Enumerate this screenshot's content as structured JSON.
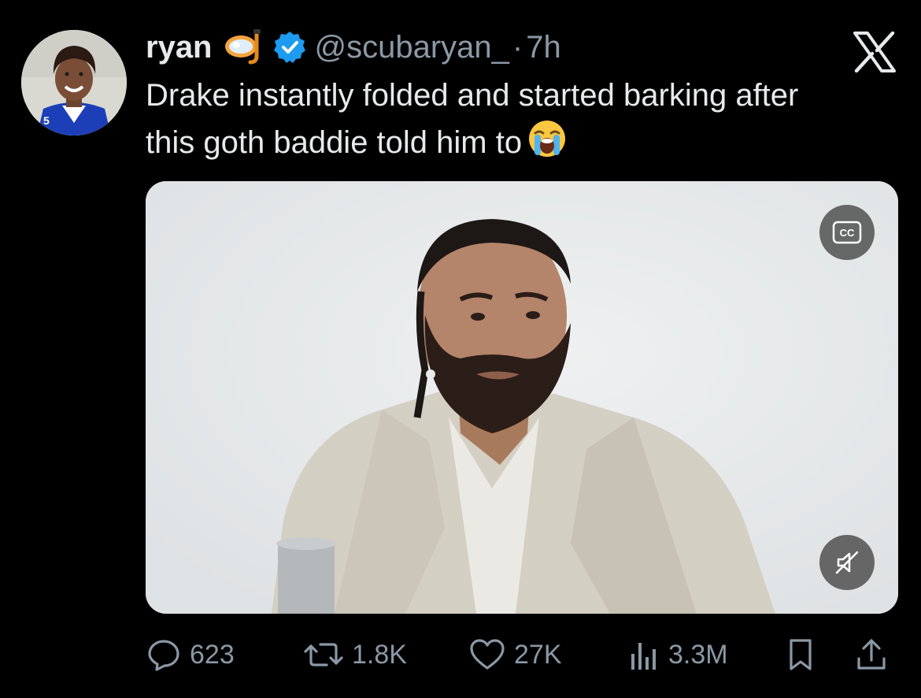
{
  "author": {
    "name": "ryan",
    "handle": "@scubaryan_",
    "separator": "·",
    "time": "7h",
    "name_emoji": "diving-mask-emoji",
    "verified": true
  },
  "tweet": {
    "text_line1": "Drake instantly folded and started barking after",
    "text_line2": "this goth baddie told him to",
    "text_emoji": "loudly-crying-face-emoji"
  },
  "media": {
    "type": "video",
    "captions_button": "CC"
  },
  "metrics": {
    "replies": "623",
    "reposts": "1.8K",
    "likes": "27K",
    "views": "3.3M"
  },
  "colors": {
    "background": "#000000",
    "text": "#e7e9ea",
    "secondary": "#8b98a5",
    "verified": "#1d9bf0"
  }
}
